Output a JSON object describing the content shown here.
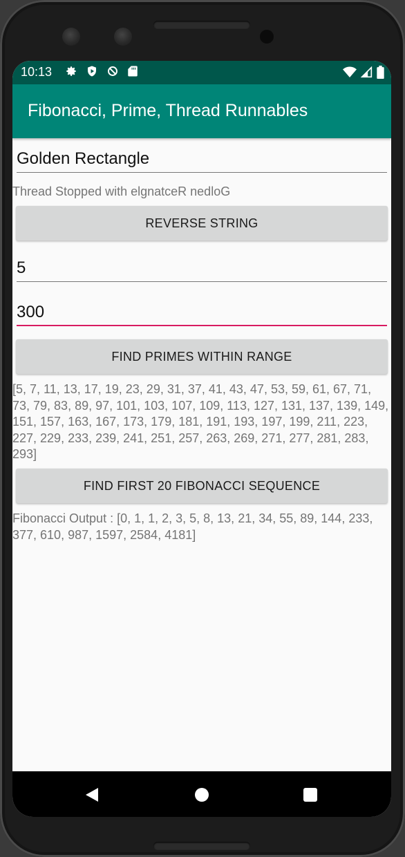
{
  "status_bar": {
    "time": "10:13",
    "left_icons": [
      "gear-icon",
      "play-protect-icon",
      "no-sync-icon",
      "sd-card-icon"
    ],
    "right_icons": [
      "wifi-icon",
      "cell-signal-icon",
      "battery-icon"
    ]
  },
  "app_bar": {
    "title": "Fibonacci, Prime, Thread Runnables",
    "color": "#008577"
  },
  "reverse": {
    "input_value": "Golden Rectangle",
    "result": "Thread Stopped with elgnatceR nedloG",
    "button_label": "REVERSE STRING"
  },
  "primes": {
    "start_value": "5",
    "end_value": "300",
    "button_label": "FIND PRIMES WITHIN RANGE",
    "result": "[5, 7, 11, 13, 17, 19, 23, 29, 31, 37, 41, 43, 47, 53, 59, 61, 67, 71, 73, 79, 83, 89, 97, 101, 103, 107, 109, 113, 127, 131, 137, 139, 149, 151, 157, 163, 167, 173, 179, 181, 191, 193, 197, 199, 211, 223, 227, 229, 233, 239, 241, 251, 257, 263, 269, 271, 277, 281, 283, 293]"
  },
  "fibonacci": {
    "button_label": "FIND FIRST 20 FIBONACCI SEQUENCE",
    "result": "Fibonacci Output : [0, 1, 1, 2, 3, 5, 8, 13, 21, 34, 55, 89, 144, 233, 377, 610, 987, 1597, 2584, 4181]"
  },
  "colors": {
    "status_bar": "#00574b",
    "accent": "#d81b60",
    "button": "#d6d7d7"
  }
}
